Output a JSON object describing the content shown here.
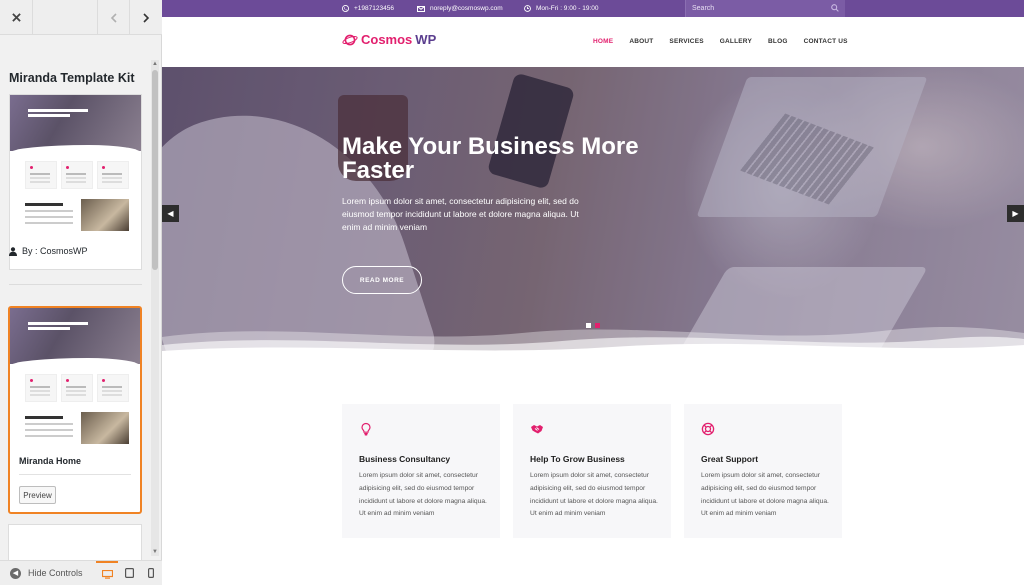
{
  "panel": {
    "kit_title": "Miranda Template Kit",
    "author": "By : CosmosWP",
    "selected_template": {
      "name": "Miranda Home",
      "preview_label": "Preview"
    },
    "thumbnail": {
      "hero_text": "Make Your Business More Faster",
      "section_text": "Make Your Business More Faster"
    },
    "hide_controls_label": "Hide Controls",
    "devices": [
      "desktop-icon",
      "tablet-icon",
      "mobile-icon"
    ],
    "active_device": "desktop"
  },
  "site": {
    "topbar": {
      "phone": "+1987123456",
      "email": "noreply@cosmoswp.com",
      "hours": "Mon-Fri : 9:00 - 19:00",
      "search_placeholder": "Search"
    },
    "logo": {
      "part1": "Cosmos",
      "part2": "WP"
    },
    "nav": [
      "HOME",
      "ABOUT",
      "SERVICES",
      "GALLERY",
      "BLOG",
      "CONTACT US"
    ],
    "hero": {
      "title": "Make Your Business More Faster",
      "text": "Lorem ipsum dolor sit amet, consectetur adipisicing elit, sed do eiusmod tempor incididunt ut labore et dolore magna aliqua. Ut enim ad minim veniam",
      "button": "READ MORE"
    },
    "features": [
      {
        "title": "Business Consultancy",
        "text": "Lorem ipsum dolor sit amet, consectetur adipisicing elit, sed do eiusmod tempor incididunt ut labore et dolore magna aliqua. Ut enim ad minim veniam",
        "icon": "lightbulb-icon"
      },
      {
        "title": "Help To Grow Business",
        "text": "Lorem ipsum dolor sit amet, consectetur adipisicing elit, sed do eiusmod tempor incididunt ut labore et dolore magna aliqua. Ut enim ad minim veniam",
        "icon": "handshake-icon"
      },
      {
        "title": "Great Support",
        "text": "Lorem ipsum dolor sit amet, consectetur adipisicing elit, sed do eiusmod tempor incididunt ut labore et dolore magna aliqua. Ut enim ad minim veniam",
        "icon": "lifebuoy-icon"
      }
    ]
  },
  "colors": {
    "accent": "#e2206e",
    "topbar": "#6c4b98",
    "panel_highlight": "#f08324"
  }
}
